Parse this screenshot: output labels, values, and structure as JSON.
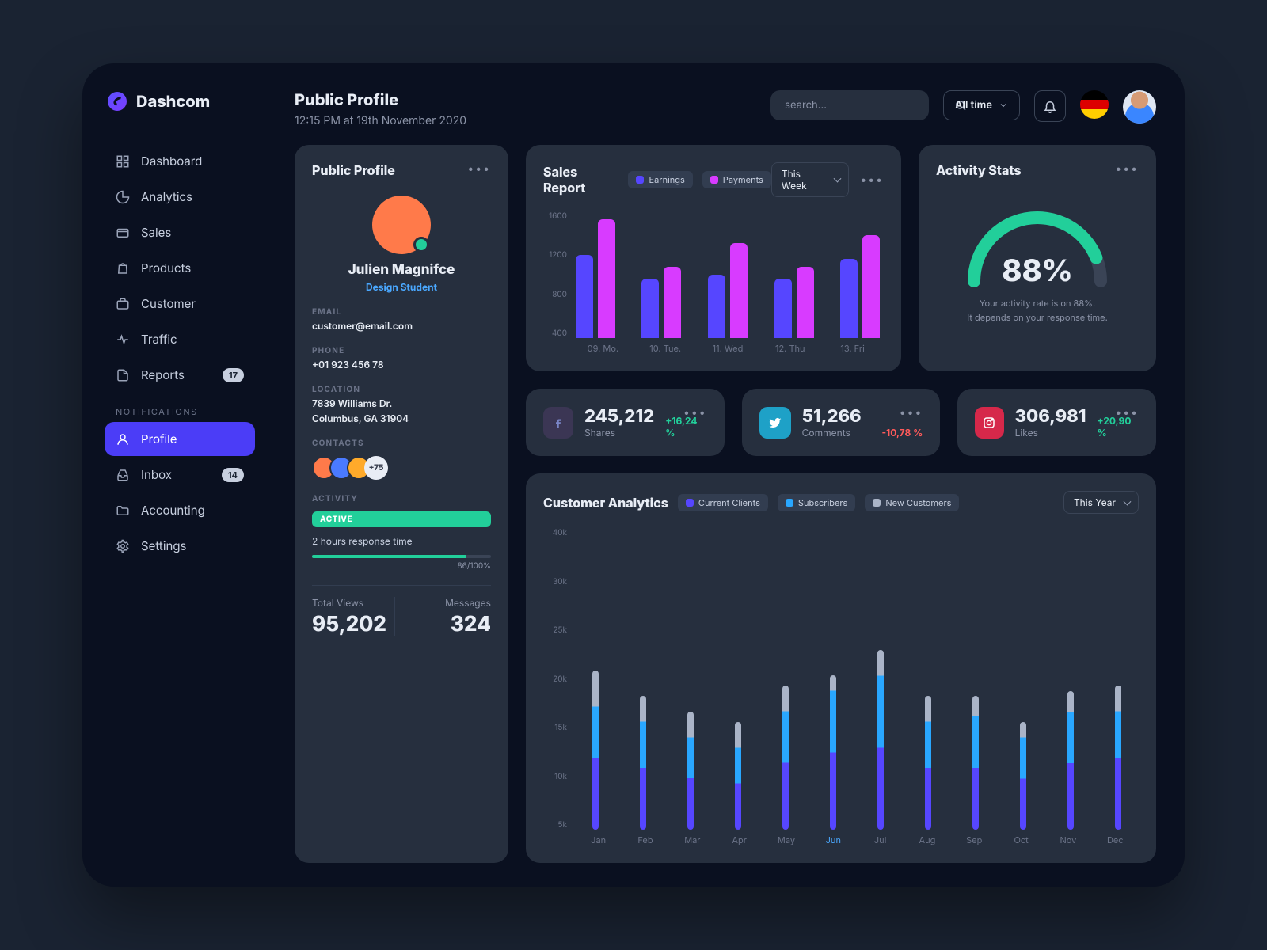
{
  "brand": "Dashcom",
  "header": {
    "title": "Public Profile",
    "subtitle": "12:15 PM at 19th November 2020",
    "search_placeholder": "search...",
    "range": "All time"
  },
  "sidebar": {
    "items": [
      {
        "label": "Dashboard",
        "icon": "grid"
      },
      {
        "label": "Analytics",
        "icon": "pie"
      },
      {
        "label": "Sales",
        "icon": "card"
      },
      {
        "label": "Products",
        "icon": "bag"
      },
      {
        "label": "Customer",
        "icon": "briefcase"
      },
      {
        "label": "Traffic",
        "icon": "activity"
      },
      {
        "label": "Reports",
        "icon": "file",
        "badge": "17"
      }
    ],
    "section_label": "NOTIFICATIONS",
    "items2": [
      {
        "label": "Profile",
        "icon": "user",
        "active": true
      },
      {
        "label": "Inbox",
        "icon": "inbox",
        "badge": "14"
      },
      {
        "label": "Accounting",
        "icon": "folder"
      },
      {
        "label": "Settings",
        "icon": "gear"
      }
    ]
  },
  "profile": {
    "card_title": "Public Profile",
    "name": "Julien Magnifce",
    "role": "Design Student",
    "email_label": "EMAIL",
    "email": "customer@email.com",
    "phone_label": "PHONE",
    "phone": "+01 923 456 78",
    "location_label": "LOCATION",
    "location1": "7839 Williams Dr.",
    "location2": "Columbus, GA 31904",
    "contacts_label": "CONTACTS",
    "contacts_more": "+75",
    "activity_label": "ACTIVITY",
    "activity_status": "ACTIVE",
    "response": "2 hours response time",
    "progress_text": "86/100%",
    "progress_pct": 86,
    "views_label": "Total Views",
    "views": "95,202",
    "messages_label": "Messages",
    "messages": "324"
  },
  "sales": {
    "title": "Sales Report",
    "legend": [
      "Earnings",
      "Payments"
    ],
    "range": "This Week"
  },
  "activity": {
    "title": "Activity Stats",
    "percent": "88%",
    "rate": 88,
    "line1": "Your activity rate is on 88%.",
    "line2": "It depends on your response time."
  },
  "kpis": [
    {
      "icon": "facebook",
      "color": "#3b3654",
      "value": "245,212",
      "label": "Shares",
      "delta": "+16,24 %",
      "dir": "up"
    },
    {
      "icon": "twitter",
      "color": "#1ea1c7",
      "value": "51,266",
      "label": "Comments",
      "delta": "-10,78 %",
      "dir": "down"
    },
    {
      "icon": "instagram",
      "color": "#d6284a",
      "value": "306,981",
      "label": "Likes",
      "delta": "+20,90 %",
      "dir": "up"
    }
  ],
  "customer": {
    "title": "Customer Analytics",
    "legend": [
      "Current Clients",
      "Subscribers",
      "New Customers"
    ],
    "range": "This Year",
    "highlight": "Jun"
  },
  "chart_data": [
    {
      "id": "sales_report",
      "type": "bar",
      "categories": [
        "09. Mo.",
        "10. Tue.",
        "11. Wed",
        "12. Thu",
        "13. Fri"
      ],
      "series": [
        {
          "name": "Earnings",
          "values": [
            1050,
            750,
            800,
            750,
            1000
          ]
        },
        {
          "name": "Payments",
          "values": [
            1500,
            900,
            1200,
            900,
            1300
          ]
        }
      ],
      "ylim": [
        0,
        1600
      ],
      "yticks": [
        400,
        800,
        1200,
        1600
      ],
      "ylabel": "",
      "xlabel": ""
    },
    {
      "id": "activity_gauge",
      "type": "gauge",
      "value": 88,
      "range": [
        0,
        100
      ]
    },
    {
      "id": "customer_analytics",
      "type": "bar",
      "categories": [
        "Jan",
        "Feb",
        "Mar",
        "Apr",
        "May",
        "Jun",
        "Jul",
        "Aug",
        "Sep",
        "Oct",
        "Nov",
        "Dec"
      ],
      "yticks": [
        5,
        10,
        15,
        20,
        25,
        30,
        40
      ],
      "ylim": [
        0,
        40
      ],
      "unit": "k",
      "series": [
        {
          "name": "Current Clients",
          "values": [
            14,
            12,
            10,
            9,
            13,
            15,
            16,
            12,
            12,
            10,
            13,
            14
          ]
        },
        {
          "name": "Subscribers",
          "values": [
            10,
            9,
            8,
            7,
            10,
            12,
            14,
            9,
            10,
            8,
            10,
            9
          ]
        },
        {
          "name": "New Customers",
          "values": [
            7,
            5,
            5,
            5,
            5,
            3,
            5,
            5,
            4,
            3,
            4,
            5
          ]
        }
      ],
      "totals": [
        31,
        26,
        23,
        21,
        28,
        30,
        35,
        26,
        26,
        21,
        27,
        28
      ]
    }
  ]
}
